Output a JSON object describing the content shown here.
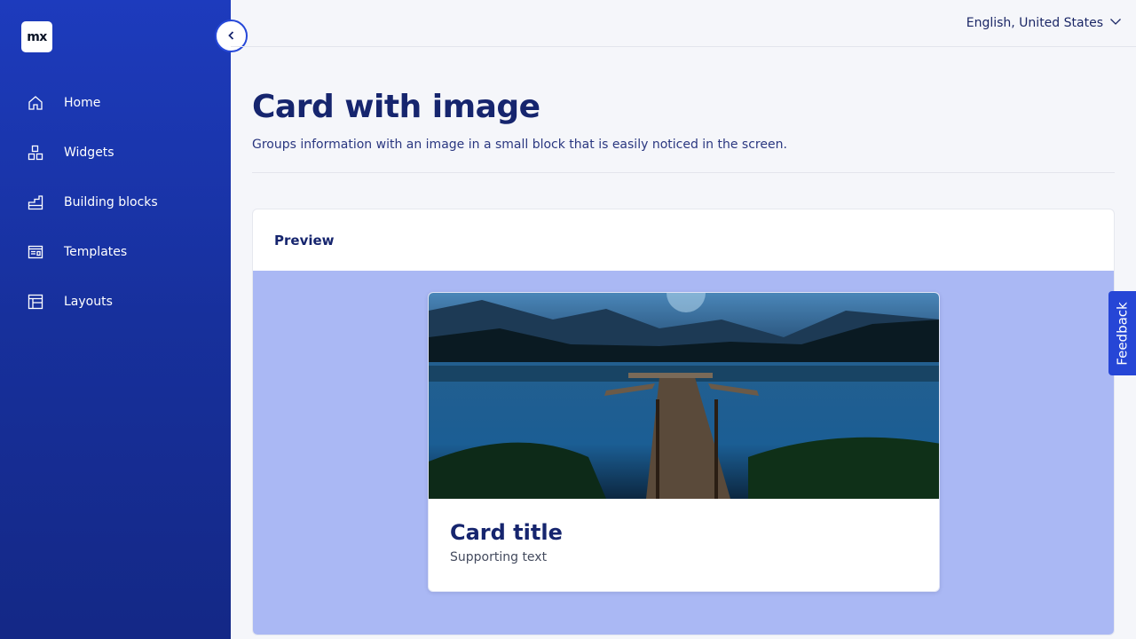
{
  "sidebar": {
    "logo_text": "mx",
    "items": [
      {
        "label": "Home",
        "icon": "home-icon"
      },
      {
        "label": "Widgets",
        "icon": "widgets-icon"
      },
      {
        "label": "Building blocks",
        "icon": "building-blocks-icon"
      },
      {
        "label": "Templates",
        "icon": "templates-icon"
      },
      {
        "label": "Layouts",
        "icon": "layouts-icon"
      }
    ],
    "collapse_icon": "chevron-left-icon"
  },
  "header": {
    "language": "English, United States",
    "language_icon": "chevron-down-icon"
  },
  "page": {
    "title": "Card with image",
    "subtitle": "Groups information with an image in a small block that is easily noticed in the screen."
  },
  "preview": {
    "heading": "Preview",
    "card": {
      "title": "Card title",
      "text": "Supporting text"
    }
  },
  "feedback": {
    "label": "Feedback"
  },
  "colors": {
    "sidebar": "#1d3bbd",
    "accent": "#2646d6",
    "preview_bg": "#aab8f4",
    "heading": "#16256e"
  }
}
